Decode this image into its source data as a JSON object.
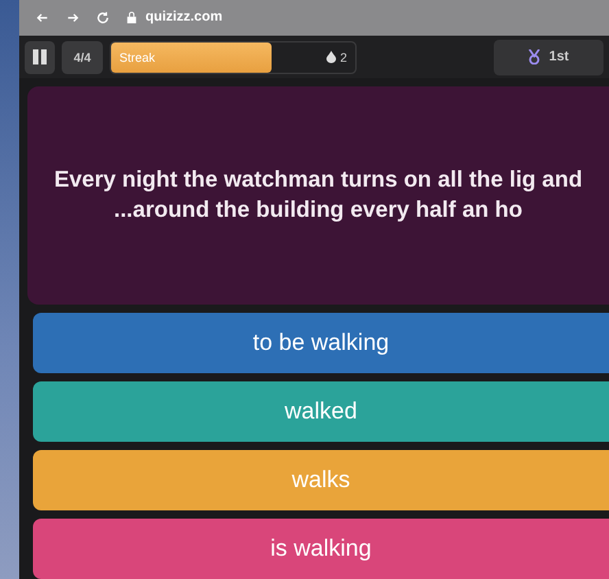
{
  "browser": {
    "url": "quizizz.com"
  },
  "toolbar": {
    "question_counter": "4/4",
    "streak": {
      "label": "Streak",
      "level": 0.66,
      "count": "2"
    },
    "rank": "1st"
  },
  "question": {
    "text": "Every night the watchman turns on all the lig and ...around the building every half an ho"
  },
  "options": [
    {
      "text": "to be walking",
      "color": "#2d6fb5"
    },
    {
      "text": "walked",
      "color": "#2ba39a"
    },
    {
      "text": "walks",
      "color": "#e9a43a"
    },
    {
      "text": "is walking",
      "color": "#d9467a"
    }
  ]
}
